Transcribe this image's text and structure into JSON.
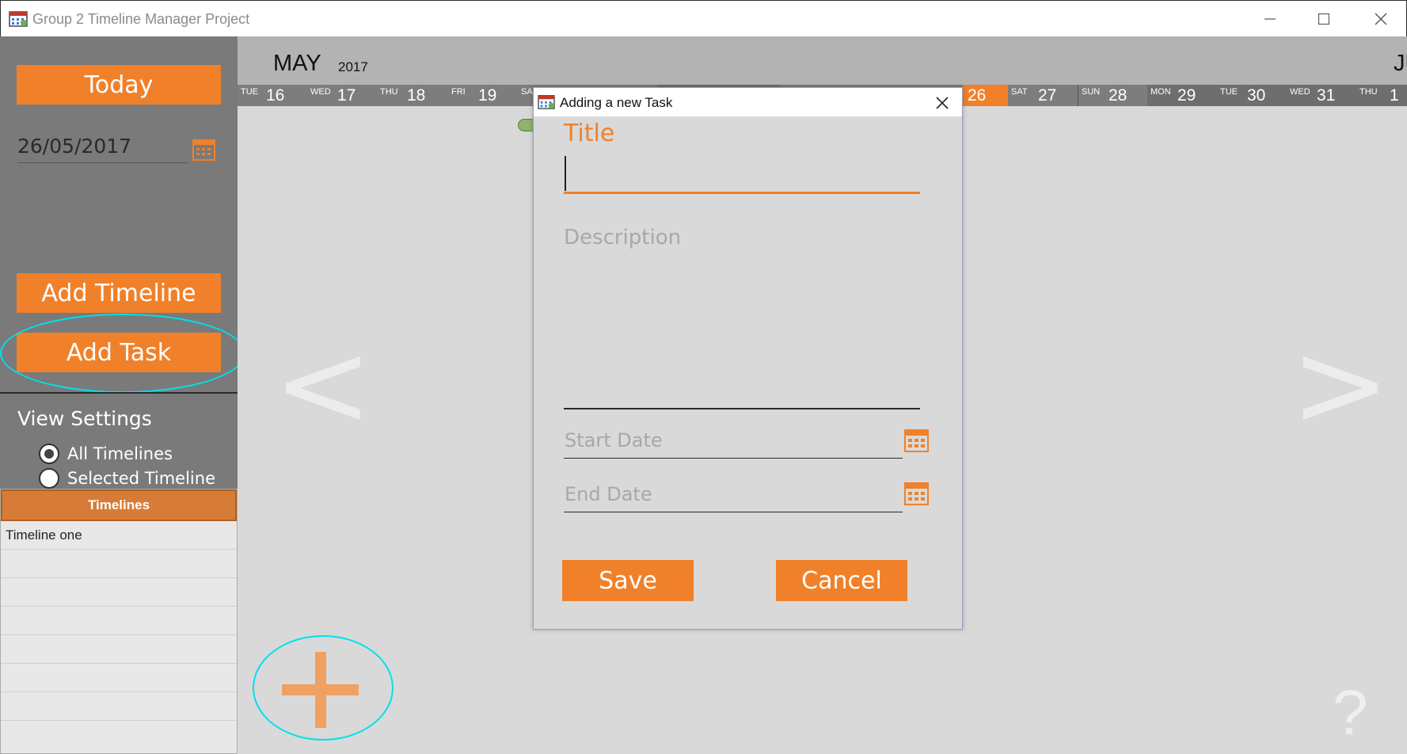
{
  "window": {
    "title": "Group 2 Timeline Manager Project",
    "controls": [
      "minimize",
      "maximize",
      "close"
    ]
  },
  "sidebar": {
    "today_label": "Today",
    "current_date": "26/05/2017",
    "add_timeline_label": "Add Timeline",
    "add_task_label": "Add Task",
    "view_settings_title": "View Settings",
    "view_options": [
      {
        "label": "All Timelines",
        "selected": true
      },
      {
        "label": "Selected Timeline",
        "selected": false
      }
    ],
    "timelines_header": "Timelines",
    "timelines": [
      "Timeline one",
      "",
      "",
      "",
      "",
      "",
      ""
    ]
  },
  "calendar": {
    "month": "MAY",
    "year": "2017",
    "next_month_partial": "JU",
    "days": [
      {
        "dow": "TUE",
        "num": "16"
      },
      {
        "dow": "WED",
        "num": "17"
      },
      {
        "dow": "THU",
        "num": "18"
      },
      {
        "dow": "FRI",
        "num": "19"
      },
      {
        "dow": "SA",
        "num": ""
      },
      {
        "dow": "",
        "num": "26",
        "today": true
      },
      {
        "dow": "SAT",
        "num": "27"
      },
      {
        "dow": "SUN",
        "num": "28"
      },
      {
        "dow": "MON",
        "num": "29"
      },
      {
        "dow": "TUE",
        "num": "30"
      },
      {
        "dow": "WED",
        "num": "31"
      },
      {
        "dow": "THU",
        "num": "1"
      }
    ],
    "prev_arrow": "<",
    "next_arrow": ">",
    "help": "?"
  },
  "dialog": {
    "title": "Adding a new Task",
    "title_label": "Title",
    "title_value": "",
    "description_placeholder": "Description",
    "start_date_placeholder": "Start Date",
    "end_date_placeholder": "End Date",
    "save_label": "Save",
    "cancel_label": "Cancel"
  },
  "colors": {
    "accent": "#f0812a",
    "sidebar": "#7a7a7a",
    "highlight": "#00e0ee"
  }
}
